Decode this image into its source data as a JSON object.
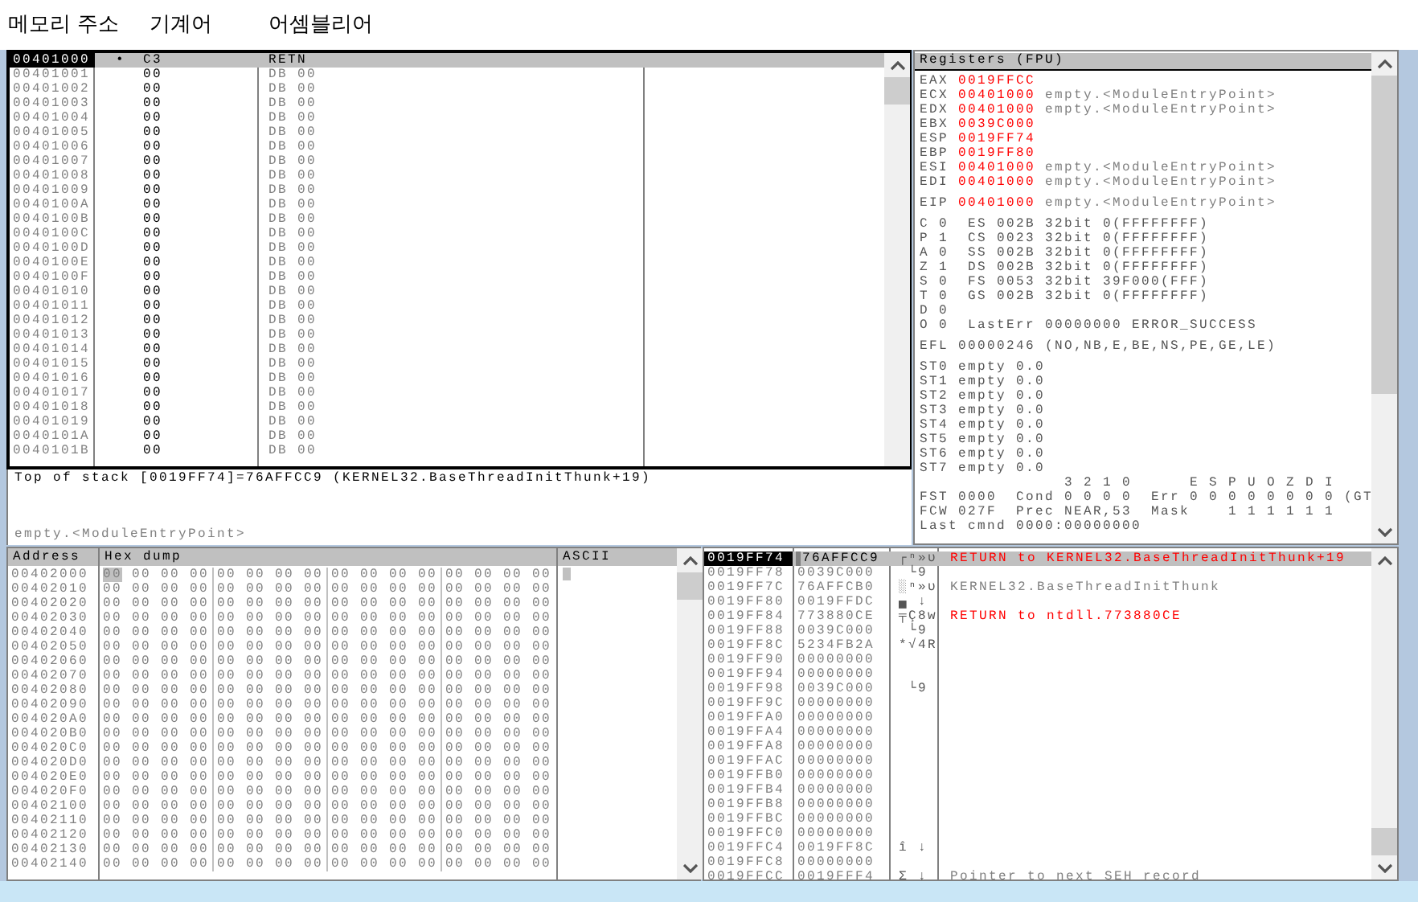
{
  "labels": [
    "메모리 주소",
    "기계어",
    "어셈블리어"
  ],
  "disassembly": {
    "rows": [
      {
        "address": "00401000",
        "marker": "•",
        "hex": "C3",
        "asm": "RETN",
        "selected": true
      },
      {
        "address": "00401001",
        "hex": "00",
        "asm": "DB 00",
        "selected": false
      },
      {
        "address": "00401002",
        "hex": "00",
        "asm": "DB 00",
        "selected": false
      },
      {
        "address": "00401003",
        "hex": "00",
        "asm": "DB 00",
        "selected": false
      },
      {
        "address": "00401004",
        "hex": "00",
        "asm": "DB 00",
        "selected": false
      },
      {
        "address": "00401005",
        "hex": "00",
        "asm": "DB 00",
        "selected": false
      },
      {
        "address": "00401006",
        "hex": "00",
        "asm": "DB 00",
        "selected": false
      },
      {
        "address": "00401007",
        "hex": "00",
        "asm": "DB 00",
        "selected": false
      },
      {
        "address": "00401008",
        "hex": "00",
        "asm": "DB 00",
        "selected": false
      },
      {
        "address": "00401009",
        "hex": "00",
        "asm": "DB 00",
        "selected": false
      },
      {
        "address": "0040100A",
        "hex": "00",
        "asm": "DB 00",
        "selected": false
      },
      {
        "address": "0040100B",
        "hex": "00",
        "asm": "DB 00",
        "selected": false
      },
      {
        "address": "0040100C",
        "hex": "00",
        "asm": "DB 00",
        "selected": false
      },
      {
        "address": "0040100D",
        "hex": "00",
        "asm": "DB 00",
        "selected": false
      },
      {
        "address": "0040100E",
        "hex": "00",
        "asm": "DB 00",
        "selected": false
      },
      {
        "address": "0040100F",
        "hex": "00",
        "asm": "DB 00",
        "selected": false
      },
      {
        "address": "00401010",
        "hex": "00",
        "asm": "DB 00",
        "selected": false
      },
      {
        "address": "00401011",
        "hex": "00",
        "asm": "DB 00",
        "selected": false
      },
      {
        "address": "00401012",
        "hex": "00",
        "asm": "DB 00",
        "selected": false
      },
      {
        "address": "00401013",
        "hex": "00",
        "asm": "DB 00",
        "selected": false
      },
      {
        "address": "00401014",
        "hex": "00",
        "asm": "DB 00",
        "selected": false
      },
      {
        "address": "00401015",
        "hex": "00",
        "asm": "DB 00",
        "selected": false
      },
      {
        "address": "00401016",
        "hex": "00",
        "asm": "DB 00",
        "selected": false
      },
      {
        "address": "00401017",
        "hex": "00",
        "asm": "DB 00",
        "selected": false
      },
      {
        "address": "00401018",
        "hex": "00",
        "asm": "DB 00",
        "selected": false
      },
      {
        "address": "00401019",
        "hex": "00",
        "asm": "DB 00",
        "selected": false
      },
      {
        "address": "0040101A",
        "hex": "00",
        "asm": "DB 00",
        "selected": false
      },
      {
        "address": "0040101B",
        "hex": "00",
        "asm": "DB 00",
        "selected": false
      }
    ]
  },
  "info": {
    "text": "Top of stack [0019FF74]=76AFFCC9 (KERNEL32.BaseThreadInitThunk+19)",
    "location": "empty.<ModuleEntryPoint>"
  },
  "registers": {
    "title": "Registers (FPU)",
    "general": [
      {
        "name": "EAX",
        "value": "0019FFCC",
        "changed": true
      },
      {
        "name": "ECX",
        "value": "00401000",
        "changed": true,
        "comment": "empty.<ModuleEntryPoint>"
      },
      {
        "name": "EDX",
        "value": "00401000",
        "changed": true,
        "comment": "empty.<ModuleEntryPoint>"
      },
      {
        "name": "EBX",
        "value": "0039C000",
        "changed": true
      },
      {
        "name": "ESP",
        "value": "0019FF74",
        "changed": true
      },
      {
        "name": "EBP",
        "value": "0019FF80",
        "changed": true
      },
      {
        "name": "ESI",
        "value": "00401000",
        "changed": true,
        "comment": "empty.<ModuleEntryPoint>"
      },
      {
        "name": "EDI",
        "value": "00401000",
        "changed": true,
        "comment": "empty.<ModuleEntryPoint>"
      }
    ],
    "eip": {
      "name": "EIP",
      "value": "00401000",
      "changed": true,
      "comment": "empty.<ModuleEntryPoint>"
    },
    "flags": [
      "C 0  ES 002B 32bit 0(FFFFFFFF)",
      "P 1  CS 0023 32bit 0(FFFFFFFF)",
      "A 0  SS 002B 32bit 0(FFFFFFFF)",
      "Z 1  DS 002B 32bit 0(FFFFFFFF)",
      "S 0  FS 0053 32bit 39F000(FFF)",
      "T 0  GS 002B 32bit 0(FFFFFFFF)",
      "D 0",
      "O 0  LastErr 00000000 ERROR_SUCCESS"
    ],
    "efl": "EFL 00000246 (NO,NB,E,BE,NS,PE,GE,LE)",
    "fpu": [
      "ST0 empty 0.0",
      "ST1 empty 0.0",
      "ST2 empty 0.0",
      "ST3 empty 0.0",
      "ST4 empty 0.0",
      "ST5 empty 0.0",
      "ST6 empty 0.0",
      "ST7 empty 0.0"
    ],
    "fpu_status": [
      "               3 2 1 0      E S P U O Z D I",
      "FST 0000  Cond 0 0 0 0  Err 0 0 0 0 0 0 0 0 (GT",
      "FCW 027F  Prec NEAR,53  Mask    1 1 1 1 1 1",
      "Last cmnd 0000:00000000"
    ]
  },
  "dump": {
    "columns": [
      "Address",
      "Hex dump",
      "ASCII"
    ],
    "rows": [
      {
        "address": "00402000",
        "hex": "00 00 00 00 00 00 00 00 00 00 00 00 00 00 00 00",
        "selected": true
      },
      {
        "address": "00402010",
        "hex": "00 00 00 00 00 00 00 00 00 00 00 00 00 00 00 00",
        "selected": false
      },
      {
        "address": "00402020",
        "hex": "00 00 00 00 00 00 00 00 00 00 00 00 00 00 00 00",
        "selected": false
      },
      {
        "address": "00402030",
        "hex": "00 00 00 00 00 00 00 00 00 00 00 00 00 00 00 00",
        "selected": false
      },
      {
        "address": "00402040",
        "hex": "00 00 00 00 00 00 00 00 00 00 00 00 00 00 00 00",
        "selected": false
      },
      {
        "address": "00402050",
        "hex": "00 00 00 00 00 00 00 00 00 00 00 00 00 00 00 00",
        "selected": false
      },
      {
        "address": "00402060",
        "hex": "00 00 00 00 00 00 00 00 00 00 00 00 00 00 00 00",
        "selected": false
      },
      {
        "address": "00402070",
        "hex": "00 00 00 00 00 00 00 00 00 00 00 00 00 00 00 00",
        "selected": false
      },
      {
        "address": "00402080",
        "hex": "00 00 00 00 00 00 00 00 00 00 00 00 00 00 00 00",
        "selected": false
      },
      {
        "address": "00402090",
        "hex": "00 00 00 00 00 00 00 00 00 00 00 00 00 00 00 00",
        "selected": false
      },
      {
        "address": "004020A0",
        "hex": "00 00 00 00 00 00 00 00 00 00 00 00 00 00 00 00",
        "selected": false
      },
      {
        "address": "004020B0",
        "hex": "00 00 00 00 00 00 00 00 00 00 00 00 00 00 00 00",
        "selected": false
      },
      {
        "address": "004020C0",
        "hex": "00 00 00 00 00 00 00 00 00 00 00 00 00 00 00 00",
        "selected": false
      },
      {
        "address": "004020D0",
        "hex": "00 00 00 00 00 00 00 00 00 00 00 00 00 00 00 00",
        "selected": false
      },
      {
        "address": "004020E0",
        "hex": "00 00 00 00 00 00 00 00 00 00 00 00 00 00 00 00",
        "selected": false
      },
      {
        "address": "004020F0",
        "hex": "00 00 00 00 00 00 00 00 00 00 00 00 00 00 00 00",
        "selected": false
      },
      {
        "address": "00402100",
        "hex": "00 00 00 00 00 00 00 00 00 00 00 00 00 00 00 00",
        "selected": false
      },
      {
        "address": "00402110",
        "hex": "00 00 00 00 00 00 00 00 00 00 00 00 00 00 00 00",
        "selected": false
      },
      {
        "address": "00402120",
        "hex": "00 00 00 00 00 00 00 00 00 00 00 00 00 00 00 00",
        "selected": false
      },
      {
        "address": "00402130",
        "hex": "00 00 00 00 00 00 00 00 00 00 00 00 00 00 00 00",
        "selected": false
      },
      {
        "address": "00402140",
        "hex": "00 00 00 00 00 00 00 00 00 00 00 00 00 00 00 00",
        "selected": false
      }
    ]
  },
  "stack": {
    "rows": [
      {
        "address": "0019FF74",
        "value": "76AFFCC9",
        "ascii": "┌ⁿ»υ",
        "comment": "RETURN to KERNEL32.BaseThreadInitThunk+19",
        "kind": "return",
        "selected": true
      },
      {
        "address": "0019FF78",
        "value": "0039C000",
        "ascii": " └9",
        "selected": false
      },
      {
        "address": "0019FF7C",
        "value": "76AFFCB0",
        "ascii": "░ⁿ»υ",
        "comment": "KERNEL32.BaseThreadInitThunk",
        "kind": "note",
        "selected": false
      },
      {
        "address": "0019FF80",
        "value": "0019FFDC",
        "ascii": "▄ ↓",
        "selected": false
      },
      {
        "address": "0019FF84",
        "value": "773880CE",
        "ascii": "╤Ç8w",
        "comment": "RETURN to ntdll.773880CE",
        "kind": "return",
        "selected": false
      },
      {
        "address": "0019FF88",
        "value": "0039C000",
        "ascii": " └9",
        "selected": false
      },
      {
        "address": "0019FF8C",
        "value": "5234FB2A",
        "ascii": "*√4R",
        "selected": false
      },
      {
        "address": "0019FF90",
        "value": "00000000",
        "selected": false
      },
      {
        "address": "0019FF94",
        "value": "00000000",
        "selected": false
      },
      {
        "address": "0019FF98",
        "value": "0039C000",
        "ascii": " └9",
        "selected": false
      },
      {
        "address": "0019FF9C",
        "value": "00000000",
        "selected": false
      },
      {
        "address": "0019FFA0",
        "value": "00000000",
        "selected": false
      },
      {
        "address": "0019FFA4",
        "value": "00000000",
        "selected": false
      },
      {
        "address": "0019FFA8",
        "value": "00000000",
        "selected": false
      },
      {
        "address": "0019FFAC",
        "value": "00000000",
        "selected": false
      },
      {
        "address": "0019FFB0",
        "value": "00000000",
        "selected": false
      },
      {
        "address": "0019FFB4",
        "value": "00000000",
        "selected": false
      },
      {
        "address": "0019FFB8",
        "value": "00000000",
        "selected": false
      },
      {
        "address": "0019FFBC",
        "value": "00000000",
        "selected": false
      },
      {
        "address": "0019FFC0",
        "value": "00000000",
        "selected": false
      },
      {
        "address": "0019FFC4",
        "value": "0019FF8C",
        "ascii": "î ↓",
        "selected": false
      },
      {
        "address": "0019FFC8",
        "value": "00000000",
        "selected": false
      },
      {
        "address": "0019FFCC",
        "value": "0019FFF4",
        "ascii": "Σ ↓",
        "comment": "Pointer to next SEH record",
        "kind": "note",
        "selected": false
      }
    ]
  }
}
